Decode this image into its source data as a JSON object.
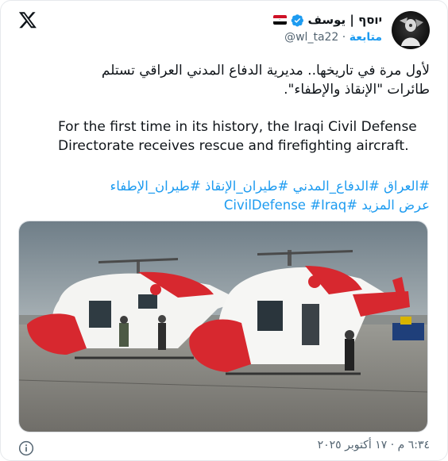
{
  "header": {
    "display_name": "יוסף | يوسف",
    "handle": "@wl_ta22",
    "separator": "·",
    "follow_label": "متابعة",
    "flag": "iraq-flag-emoji",
    "verified": "verified-badge-icon",
    "x_logo": "x-logo-icon"
  },
  "tweet": {
    "text_ar_line1": "لأول مرة في تاريخها.. مديرية الدفاع المدني العراقي تستلم",
    "text_ar_line2": "طائرات \"الإنقاذ والإطفاء\".",
    "text_en": "For the first time in its history, the Iraqi Civil Defense Directorate receives rescue and firefighting aircraft.",
    "hashtags": [
      "#العراق",
      "#الدفاع_المدني",
      "#طيران_الإنقاذ",
      "#طيران_الإطفاء",
      "#Iraq",
      "#CivilDefense"
    ],
    "show_more": "عرض المزيد",
    "timestamp": "٦:٣٤ م · ١٧ أكتوبر ٢٠٢٥"
  },
  "photo": {
    "subject": "two red and white rescue helicopters on airfield"
  },
  "colors": {
    "link": "#1d9bf0",
    "muted": "#536471",
    "text": "#0f1419"
  }
}
